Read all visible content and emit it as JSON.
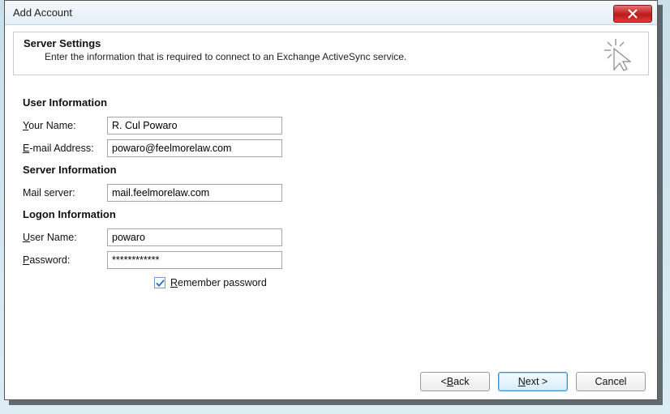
{
  "window": {
    "title": "Add Account"
  },
  "header": {
    "title": "Server Settings",
    "subtitle": "Enter the information that is required to connect to an Exchange ActiveSync service."
  },
  "sections": {
    "user_info_title": "User Information",
    "server_info_title": "Server Information",
    "logon_info_title": "Logon Information"
  },
  "labels": {
    "your_name_pre": "Y",
    "your_name_post": "our Name:",
    "email_pre": "E",
    "email_post": "-mail Address:",
    "mail_server": "Mail server:",
    "user_name_pre": "U",
    "user_name_post": "ser Name:",
    "password_pre": "P",
    "password_post": "assword:",
    "remember_pre": "R",
    "remember_post": "emember password"
  },
  "values": {
    "your_name": "R. Cul Powaro",
    "email": "powaro@feelmorelaw.com",
    "mail_server": "mail.feelmorelaw.com",
    "user_name": "powaro",
    "password": "************",
    "remember_checked": true
  },
  "buttons": {
    "back": "< ",
    "back_u": "B",
    "back_post": "ack",
    "next_u": "N",
    "next_post": "ext >",
    "cancel": "Cancel"
  }
}
